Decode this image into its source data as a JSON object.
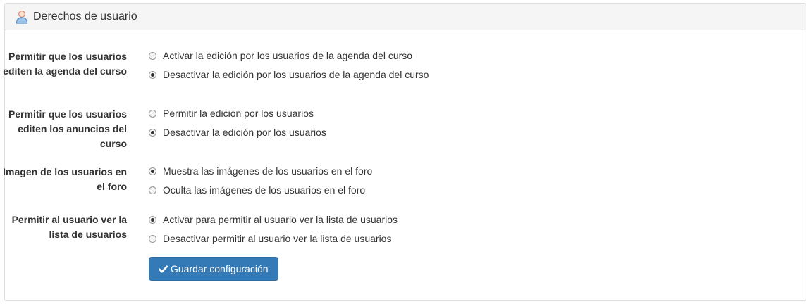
{
  "panel": {
    "title": "Derechos de usuario",
    "icon": "user-icon"
  },
  "settings": [
    {
      "label": "Permitir que los usuarios editen la agenda del curso",
      "options": [
        {
          "label": "Activar la edición por los usuarios de la agenda del curso",
          "checked": false
        },
        {
          "label": "Desactivar la edición por los usuarios de la agenda del curso",
          "checked": true
        }
      ]
    },
    {
      "label": "Permitir que los usuarios editen los anuncios del curso",
      "options": [
        {
          "label": "Permitir la edición por los usuarios",
          "checked": false
        },
        {
          "label": "Desactivar la edición por los usuarios",
          "checked": true
        }
      ]
    },
    {
      "label": "Imagen de los usuarios en el foro",
      "options": [
        {
          "label": "Muestra las imágenes de los usuarios en el foro",
          "checked": true
        },
        {
          "label": "Oculta las imágenes de los usuarios en el foro",
          "checked": false
        }
      ]
    },
    {
      "label": "Permitir al usuario ver la lista de usuarios",
      "options": [
        {
          "label": "Activar para permitir al usuario ver la lista de usuarios",
          "checked": true
        },
        {
          "label": "Desactivar permitir al usuario ver la lista de usuarios",
          "checked": false
        }
      ]
    }
  ],
  "save_button": {
    "label": "Guardar configuración",
    "icon": "check-icon",
    "color": "#337ab7"
  }
}
